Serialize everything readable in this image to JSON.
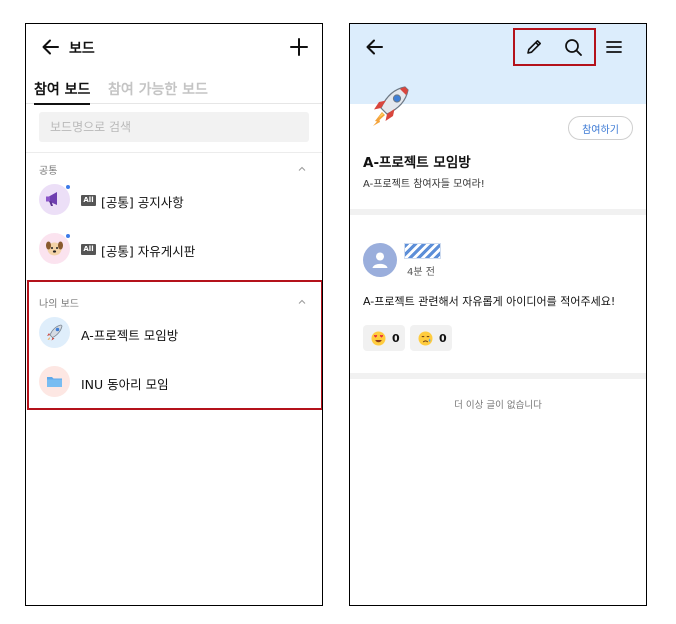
{
  "left_screen": {
    "header_title": "보드",
    "tabs": [
      {
        "label": "참여 보드",
        "active": true
      },
      {
        "label": "참여 가능한 보드",
        "active": false
      }
    ],
    "search_placeholder": "보드명으로 검색",
    "sections": [
      {
        "label": "공통",
        "items": [
          {
            "badge": "All",
            "label": "[공통] 공지사항",
            "icon": "megaphone-icon",
            "new_dot": true
          },
          {
            "badge": "All",
            "label": "[공통] 자유게시판",
            "icon": "dog-face-icon",
            "new_dot": true
          }
        ]
      },
      {
        "label": "나의 보드",
        "items": [
          {
            "label": "A-프로젝트 모임방",
            "icon": "rocket-icon"
          },
          {
            "label": "INU 동아리 모임",
            "icon": "folder-icon"
          }
        ]
      }
    ],
    "highlight_color": "#b4121b"
  },
  "right_screen": {
    "header_icons": [
      "back-arrow-icon",
      "pencil-icon",
      "search-icon",
      "menu-icon"
    ],
    "board_icon": "rocket-icon",
    "join_button": "참여하기",
    "board_title": "A-프로젝트 모임방",
    "board_description": "A-프로젝트 참여자들 모여라!",
    "post": {
      "time": "4분 전",
      "body": "A-프로젝트 관련해서 자유롭게 아이디어를 적어주세요!",
      "reactions": [
        {
          "emoji": "heart-eyes-icon",
          "count": "0"
        },
        {
          "emoji": "crying-face-icon",
          "count": "0"
        }
      ]
    },
    "empty_message": "더 이상 글이 없습니다",
    "header_color": "#dcedfc",
    "accent_color": "#3a78d4"
  }
}
